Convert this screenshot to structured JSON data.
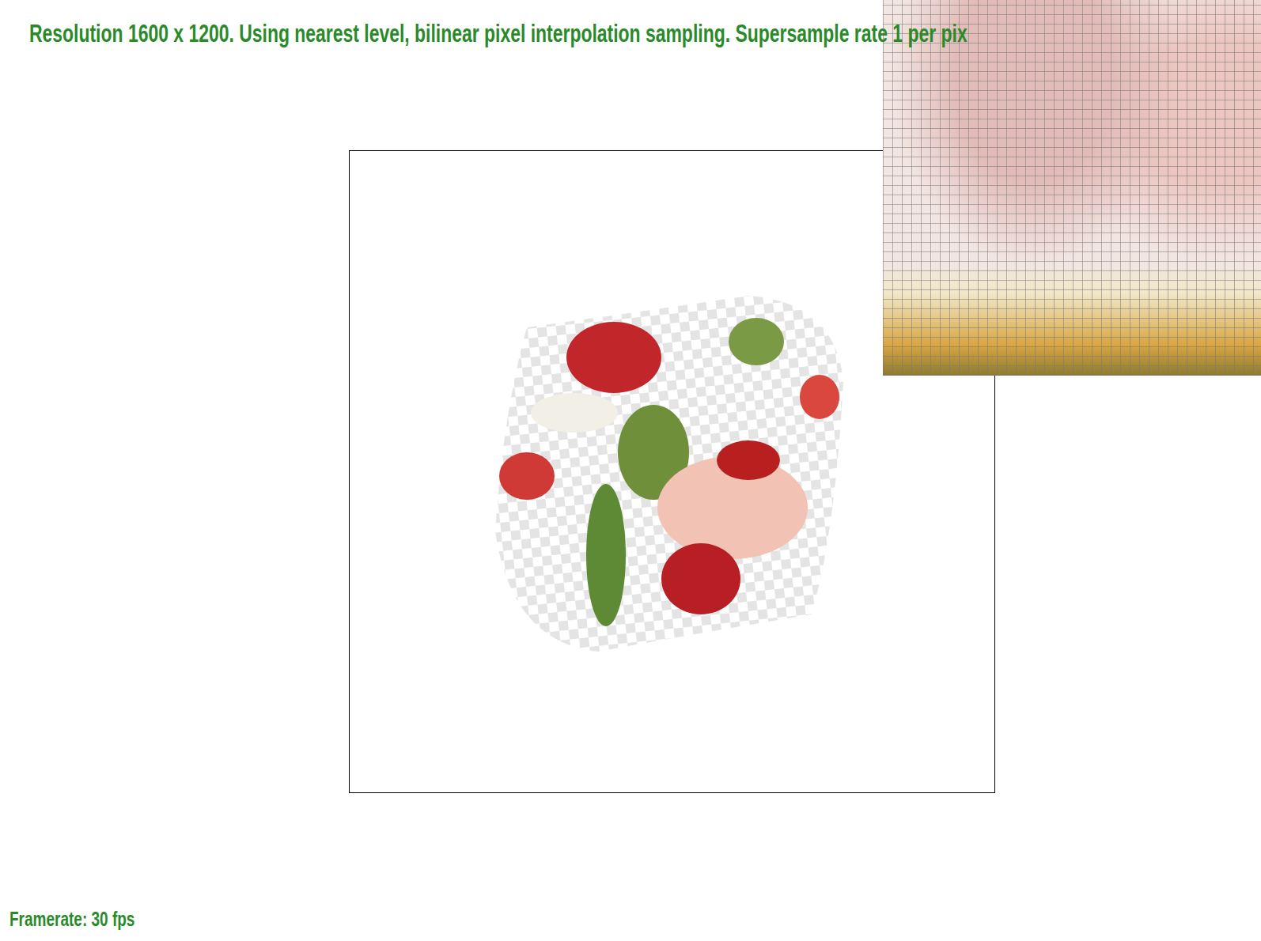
{
  "header": {
    "text": "Resolution 1600 x 1200. Using nearest level, bilinear pixel interpolation sampling. Supersample rate 1 per pix"
  },
  "status": {
    "framerate": "Framerate: 30 fps"
  }
}
